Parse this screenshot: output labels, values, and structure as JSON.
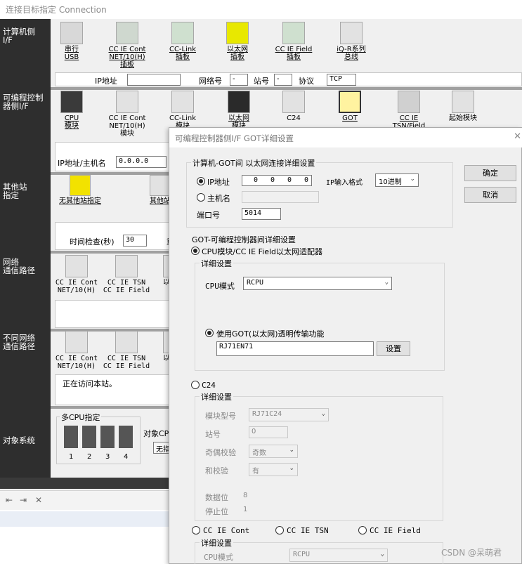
{
  "window": {
    "title": "连接目标指定 Connection"
  },
  "side_labels": {
    "pc_if": "计算机侧\nI/F",
    "plc_if": "可编程控制\n器侧I/F",
    "other_station": "其他站\n指定",
    "network_route": "网络\n通信路径",
    "diff_network_route": "不同网络\n通信路径",
    "target_system": "对象系统"
  },
  "pc_if_items": [
    {
      "label": "串行\nUSB",
      "icon": "serial-usb-icon"
    },
    {
      "label": "CC IE Cont\nNET/10(H)\n插板",
      "icon": "cc-ie-board-icon"
    },
    {
      "label": "CC-Link\n插板",
      "icon": "cclink-board-icon"
    },
    {
      "label": "以太网\n插板",
      "icon": "ethernet-board-icon"
    },
    {
      "label": "CC IE Field\n插板",
      "icon": "cc-ie-field-board-icon"
    },
    {
      "label": "iQ-R系列\n总线",
      "icon": "iqr-bus-icon"
    }
  ],
  "pc_if_row": {
    "ip_label": "IP地址",
    "ip_value": "",
    "net_label": "网络号",
    "net_value": "-",
    "station_label": "站号",
    "station_value": "-",
    "protocol_label": "协议",
    "protocol_value": "TCP"
  },
  "plc_if_items": [
    {
      "label": "CPU\n模块",
      "icon": "cpu-module-icon"
    },
    {
      "label": "CC IE Cont\nNET/10(H)\n模块",
      "icon": "cc-ie-module-icon"
    },
    {
      "label": "CC-Link\n模块",
      "icon": "cclink-module-icon"
    },
    {
      "label": "以太网\n模块",
      "icon": "ethernet-module-icon"
    },
    {
      "label": "C24",
      "icon": "c24-icon"
    },
    {
      "label": "GOT",
      "icon": "got-icon"
    },
    {
      "label": "CC IE\nTSN/Field",
      "icon": "tsn-field-icon"
    },
    {
      "label": "起始模块",
      "icon": "head-module-icon"
    }
  ],
  "plc_if_row": {
    "ip_host_label": "IP地址/主机名",
    "ip_host_value": "0.0.0.0"
  },
  "other_station": {
    "none_label": "无其他站指定",
    "other_label": "其他站",
    "time_check_label": "时间检查(秒)",
    "time_check_value": "30",
    "retry_label": "重"
  },
  "network_route_items": [
    {
      "label": "CC IE Cont\nNET/10(H)"
    },
    {
      "label": "CC IE TSN\nCC IE Field"
    },
    {
      "label": "以"
    }
  ],
  "diff_network_items": [
    {
      "label": "CC IE Cont\nNET/10(H)"
    },
    {
      "label": "CC IE TSN\nCC IE Field"
    },
    {
      "label": "以"
    }
  ],
  "status_text": "正在访问本站。",
  "multi_cpu": {
    "title": "多CPU指定",
    "numbers": [
      "1",
      "2",
      "3",
      "4"
    ],
    "target_label": "对象CP",
    "target_value": "无指"
  },
  "dialog": {
    "title": "可编程控制器侧I/F GOT详细设置",
    "ok": "确定",
    "cancel": "取消",
    "pc_got_group": "计算机-GOT间 以太网连接详细设置",
    "ip_radio": "IP地址",
    "ip_segments": [
      "0",
      "0",
      "0",
      "0"
    ],
    "ip_format_label": "IP输入格式",
    "ip_format_value": "10进制",
    "host_radio": "主机名",
    "host_value": "",
    "port_label": "端口号",
    "port_value": "5014",
    "got_plc_group": "GOT-可编程控制器间详细设置",
    "cpu_radio": "CPU模块/CC IE Field以太网适配器",
    "detail_group": "详细设置",
    "cpu_mode_label": "CPU模式",
    "cpu_mode_value": "RCPU",
    "transparent_radio": "使用GOT(以太网)透明传输功能",
    "transparent_value": "RJ71EN71",
    "settings_btn": "设置",
    "c24_radio": "C24",
    "c24_detail_group": "详细设置",
    "module_model_label": "模块型号",
    "module_model_value": "RJ71C24",
    "station_label": "站号",
    "station_value": "0",
    "parity_label": "奇偶校验",
    "parity_value": "奇数",
    "sum_check_label": "和校验",
    "sum_check_value": "有",
    "data_bits_label": "数据位",
    "data_bits_value": "8",
    "stop_bits_label": "停止位",
    "stop_bits_value": "1",
    "cc_ie_cont_radio": "CC IE Cont",
    "cc_ie_tsn_radio": "CC IE TSN",
    "cc_ie_field_radio": "CC IE Field",
    "bottom_detail_group": "详细设置",
    "bottom_cpu_mode_label": "CPU模式",
    "bottom_cpu_mode_value": "RCPU"
  },
  "watermark": "CSDN @呆萌君"
}
